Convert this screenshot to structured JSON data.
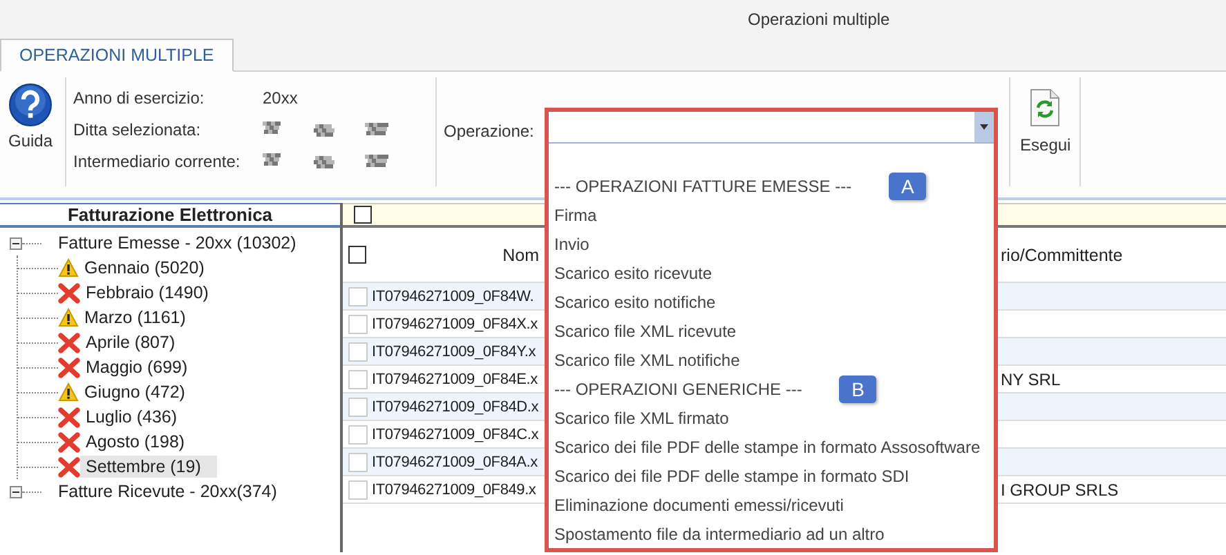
{
  "window": {
    "title": "Operazioni multiple"
  },
  "tabs": [
    {
      "label": "OPERAZIONI MULTIPLE",
      "selected": true
    }
  ],
  "ribbon": {
    "help_button": "Guida",
    "info": [
      {
        "label": "Anno di esercizio:",
        "value": "20xx"
      },
      {
        "label": "Ditta selezionata:",
        "redacted": true
      },
      {
        "label": "Intermediario corrente:",
        "redacted": true
      }
    ],
    "operation": {
      "label": "Operazione:",
      "open": true,
      "options": [
        {
          "kind": "header",
          "label": "--- OPERAZIONI FATTURE EMESSE ---",
          "badge": "A"
        },
        {
          "kind": "option",
          "label": "Firma"
        },
        {
          "kind": "option",
          "label": "Invio"
        },
        {
          "kind": "option",
          "label": "Scarico esito ricevute"
        },
        {
          "kind": "option",
          "label": "Scarico esito notifiche"
        },
        {
          "kind": "option",
          "label": "Scarico file XML ricevute"
        },
        {
          "kind": "option",
          "label": "Scarico file XML notifiche"
        },
        {
          "kind": "header",
          "label": "--- OPERAZIONI GENERICHE ---",
          "badge": "B"
        },
        {
          "kind": "option",
          "label": "Scarico file XML firmato"
        },
        {
          "kind": "option",
          "label": "Scarico dei file PDF delle stampe in formato Assosoftware"
        },
        {
          "kind": "option",
          "label": "Scarico dei file PDF delle stampe in formato SDI"
        },
        {
          "kind": "option",
          "label": "Eliminazione documenti emessi/ricevuti"
        },
        {
          "kind": "option",
          "label": "Spostamento file da intermediario ad un altro"
        }
      ]
    },
    "run_button": "Esegui"
  },
  "tree": {
    "title": "Fatturazione Elettronica",
    "nodes": [
      {
        "label": "Fatture Emesse - 20xx (10302)",
        "expanded": true,
        "children": [
          {
            "label": "Gennaio (5020)",
            "kind": "warning",
            "selected": false
          },
          {
            "label": "Febbraio (1490)",
            "kind": "error",
            "selected": false
          },
          {
            "label": "Marzo (1161)",
            "kind": "warning",
            "selected": false
          },
          {
            "label": "Aprile (807)",
            "kind": "error",
            "selected": false
          },
          {
            "label": "Maggio (699)",
            "kind": "error",
            "selected": false
          },
          {
            "label": "Giugno (472)",
            "kind": "warning",
            "selected": false
          },
          {
            "label": "Luglio (436)",
            "kind": "error",
            "selected": false
          },
          {
            "label": "Agosto (198)",
            "kind": "error",
            "selected": false
          },
          {
            "label": "Settembre (19)",
            "kind": "error",
            "selected": true
          }
        ]
      },
      {
        "label": "Fatture Ricevute - 20xx(374)",
        "expanded": true
      }
    ]
  },
  "grid": {
    "filter_checked": false,
    "select_all_checked": false,
    "columns": [
      "Nom",
      "rio/Committente"
    ],
    "rows": [
      {
        "checked": false,
        "name": "IT07946271009_0F84W."
      },
      {
        "checked": false,
        "name": "IT07946271009_0F84X.x"
      },
      {
        "checked": false,
        "name": "IT07946271009_0F84Y.x"
      },
      {
        "checked": false,
        "name": "IT07946271009_0F84E.x",
        "customer": "NY SRL"
      },
      {
        "checked": false,
        "name": "IT07946271009_0F84D.x"
      },
      {
        "checked": false,
        "name": "IT07946271009_0F84C.x"
      },
      {
        "checked": false,
        "name": "IT07946271009_0F84A.x"
      },
      {
        "checked": false,
        "name": "IT07946271009_0F849.x",
        "customer": "I GROUP SRLS"
      }
    ]
  }
}
